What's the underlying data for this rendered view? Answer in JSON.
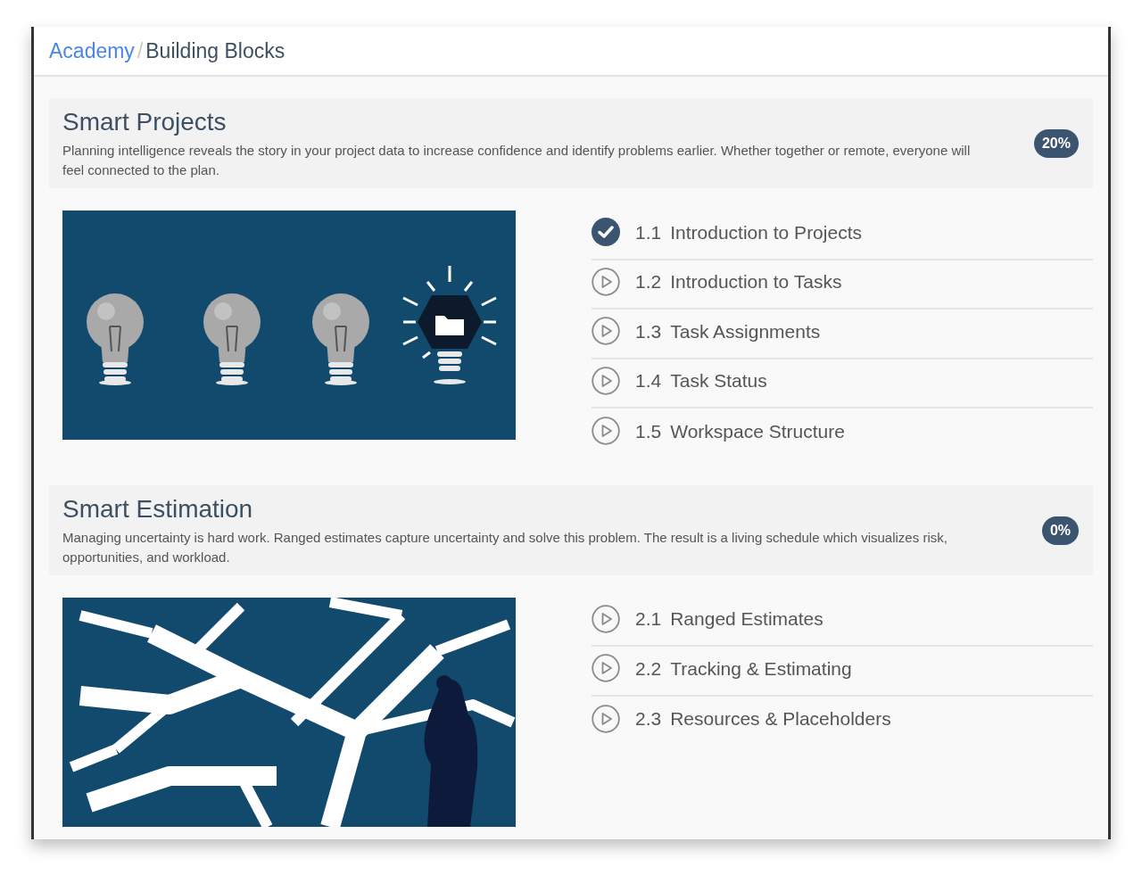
{
  "breadcrumb": {
    "link": "Academy",
    "separator": "/",
    "current": "Building Blocks"
  },
  "modules": [
    {
      "title": "Smart Projects",
      "description": "Planning intelligence reveals the story in your project data to increase confidence and identify problems earlier. Whether together or remote, everyone will feel connected to the plan.",
      "progress": "20%",
      "kind": "bulbs",
      "lessons": [
        {
          "number": "1.1",
          "title": "Introduction to Projects",
          "completed": true
        },
        {
          "number": "1.2",
          "title": "Introduction to Tasks",
          "completed": false
        },
        {
          "number": "1.3",
          "title": "Task Assignments",
          "completed": false
        },
        {
          "number": "1.4",
          "title": "Task Status",
          "completed": false
        },
        {
          "number": "1.5",
          "title": "Workspace Structure",
          "completed": false
        }
      ]
    },
    {
      "title": "Smart Estimation",
      "description": "Managing uncertainty is hard work. Ranged estimates capture uncertainty and solve this problem. The result is a living schedule which visualizes risk, opportunities, and workload.",
      "progress": "0%",
      "kind": "paths",
      "lessons": [
        {
          "number": "2.1",
          "title": "Ranged Estimates",
          "completed": false
        },
        {
          "number": "2.2",
          "title": "Tracking & Estimating",
          "completed": false
        },
        {
          "number": "2.3",
          "title": "Resources & Placeholders",
          "completed": false
        }
      ]
    }
  ]
}
